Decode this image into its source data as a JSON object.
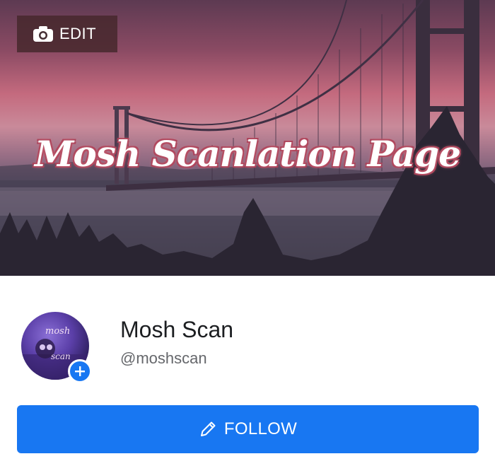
{
  "cover": {
    "edit_label": "EDIT",
    "title": "Mosh Scanlation Page"
  },
  "profile": {
    "avatar_text_top": "mosh",
    "avatar_text_bottom": "scan",
    "name": "Mosh Scan",
    "handle": "@moshscan"
  },
  "actions": {
    "follow_label": "FOLLOW"
  },
  "colors": {
    "accent": "#1877f2",
    "name_text": "#1c1e21",
    "handle_text": "#65676b"
  },
  "icons": {
    "edit": "camera-icon",
    "badge": "plus-icon",
    "follow": "pencil-icon"
  }
}
